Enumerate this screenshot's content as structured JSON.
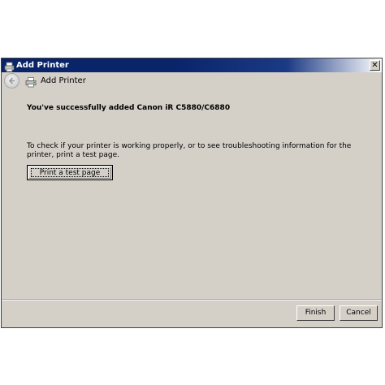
{
  "window": {
    "title": "Add Printer",
    "close_glyph": "✕"
  },
  "nav": {
    "title": "Add Printer",
    "back_icon": "back-arrow-icon",
    "printer_icon": "printer-icon"
  },
  "content": {
    "heading": "You've successfully added Canon iR C5880/C6880",
    "info": "To check if your printer is working properly, or to see troubleshooting information for the printer, print a test page.",
    "test_page_button": "Print a test page"
  },
  "footer": {
    "finish_label": "Finish",
    "cancel_label": "Cancel"
  },
  "colors": {
    "titlebar": "#0a246a",
    "face": "#d4d0c8"
  }
}
